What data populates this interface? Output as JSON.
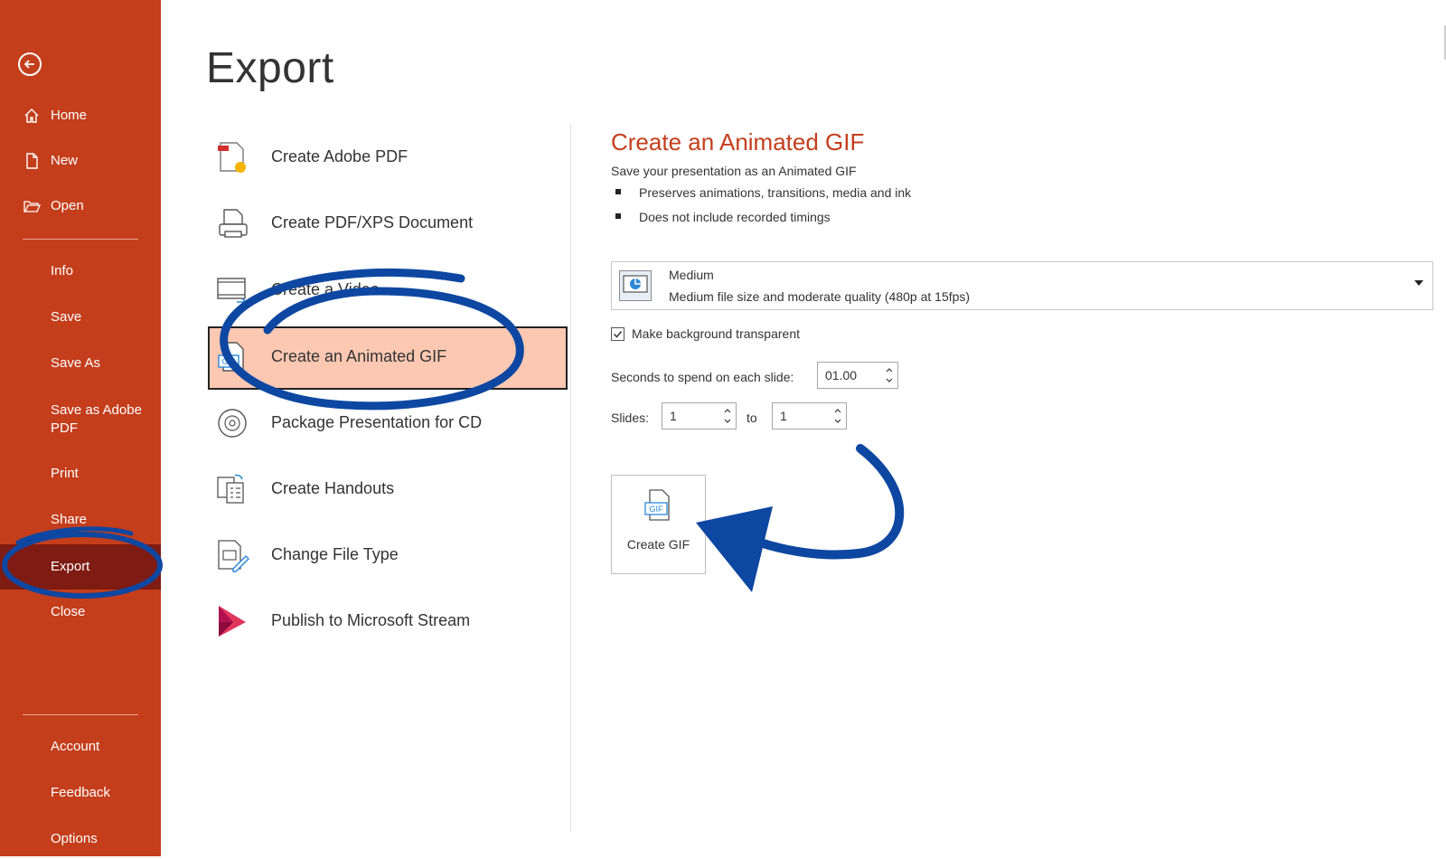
{
  "sidebar": {
    "items": [
      {
        "label": "Home",
        "icon": "home-icon"
      },
      {
        "label": "New",
        "icon": "new-document-icon"
      },
      {
        "label": "Open",
        "icon": "open-folder-icon"
      },
      {
        "label": "Info"
      },
      {
        "label": "Save"
      },
      {
        "label": "Save As"
      },
      {
        "label": "Save as Adobe PDF"
      },
      {
        "label": "Print"
      },
      {
        "label": "Share"
      },
      {
        "label": "Export",
        "active": true
      },
      {
        "label": "Close"
      },
      {
        "label": "Account"
      },
      {
        "label": "Feedback"
      },
      {
        "label": "Options"
      }
    ],
    "colors": {
      "background": "#c43e1c",
      "active": "#7e1b12"
    }
  },
  "page": {
    "title": "Export"
  },
  "export_options": [
    {
      "label": "Create Adobe PDF",
      "icon": "adobe-pdf-icon"
    },
    {
      "label": "Create PDF/XPS Document",
      "icon": "pdf-xps-icon"
    },
    {
      "label": "Create a Video",
      "icon": "video-icon"
    },
    {
      "label": "Create an Animated GIF",
      "icon": "gif-icon",
      "selected": true
    },
    {
      "label": "Package Presentation for CD",
      "icon": "cd-icon"
    },
    {
      "label": "Create Handouts",
      "icon": "handouts-icon"
    },
    {
      "label": "Change File Type",
      "icon": "change-file-type-icon"
    },
    {
      "label": "Publish to Microsoft Stream",
      "icon": "stream-icon"
    }
  ],
  "details": {
    "title": "Create an Animated GIF",
    "description": "Save your presentation as an Animated GIF",
    "bullets": [
      "Preserves animations, transitions, media and ink",
      "Does not include recorded timings"
    ],
    "quality": {
      "name": "Medium",
      "description": "Medium file size and moderate quality (480p at 15fps)"
    },
    "transparent_label": "Make background transparent",
    "transparent_checked": true,
    "seconds_label": "Seconds to spend on each slide:",
    "seconds_value": "01.00",
    "slides_label": "Slides:",
    "slides_from": "1",
    "slides_to_label": "to",
    "slides_to": "1",
    "create_button": {
      "label": "Create GIF",
      "icon_text": "GIF"
    },
    "accent_color": "#c43e1c"
  },
  "annotation_color": "#0d47a1"
}
